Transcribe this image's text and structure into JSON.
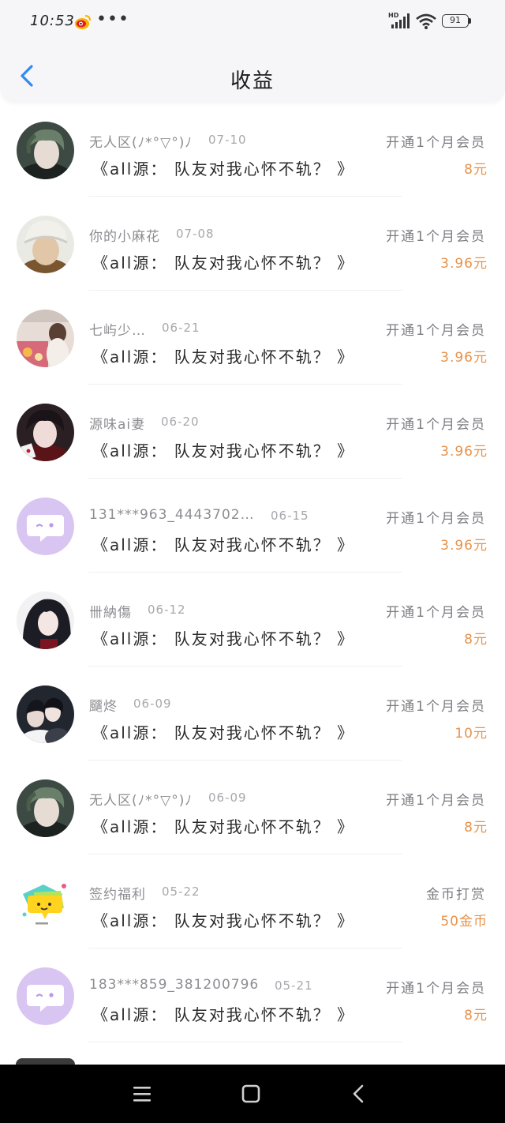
{
  "status_bar": {
    "time": "10:53",
    "dots": "•••",
    "battery": "91"
  },
  "header": {
    "title": "收益"
  },
  "book_title": "《all源： 队友对我心怀不轨？ 》",
  "rows": [
    {
      "name": "无人区(ﾉ*°▽°)ﾉ",
      "date": "07-10",
      "type": "开通1个月会员",
      "amount": "8元",
      "avatar": "boy-green"
    },
    {
      "name": "你的小麻花",
      "date": "07-08",
      "type": "开通1个月会员",
      "amount": "3.96元",
      "avatar": "boy-hat"
    },
    {
      "name": "七屿少…",
      "date": "06-21",
      "type": "开通1个月会员",
      "amount": "3.96元",
      "avatar": "girl-pink"
    },
    {
      "name": "源味ai妻",
      "date": "06-20",
      "type": "开通1个月会员",
      "amount": "3.96元",
      "avatar": "boy-red"
    },
    {
      "name": "131***963_4443702…",
      "date": "06-15",
      "type": "开通1个月会员",
      "amount": "3.96元",
      "avatar": "default-purple"
    },
    {
      "name": "卌納傷",
      "date": "06-12",
      "type": "开通1个月会员",
      "amount": "8元",
      "avatar": "anime-dark"
    },
    {
      "name": "飅炵",
      "date": "06-09",
      "type": "开通1个月会员",
      "amount": "10元",
      "avatar": "couple"
    },
    {
      "name": "无人区(ﾉ*°▽°)ﾉ",
      "date": "06-09",
      "type": "开通1个月会员",
      "amount": "8元",
      "avatar": "boy-green"
    },
    {
      "name": "签约福利",
      "date": "05-22",
      "type": "金币打赏",
      "amount": "50金币",
      "avatar": "yellow-bubble"
    },
    {
      "name": "183***859_381200796",
      "date": "05-21",
      "type": "开通1个月会员",
      "amount": "8元",
      "avatar": "default-purple"
    }
  ],
  "colors": {
    "accent_blue": "#2f8bf0",
    "amount_orange": "#e8924a",
    "avatar_purple": "#d9c5f2"
  }
}
